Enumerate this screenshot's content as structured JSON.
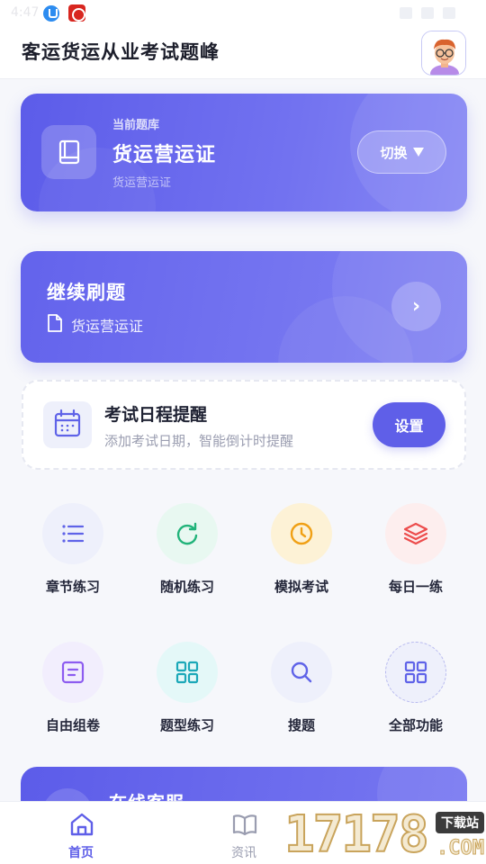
{
  "status_bar": {
    "time": "4:47"
  },
  "header": {
    "title": "客运货运从业考试题峰"
  },
  "current_bank": {
    "label": "当前题库",
    "name": "货运营运证",
    "sub": "货运营运证",
    "switch_label": "切换"
  },
  "continue_card": {
    "title": "继续刷题",
    "sub": "货运营运证",
    "arrow": "›"
  },
  "reminder": {
    "title": "考试日程提醒",
    "sub": "添加考试日期，智能倒计时提醒",
    "button": "设置"
  },
  "features": [
    {
      "label": "章节练习",
      "icon": "list-icon",
      "color": "#5f63e8",
      "bg": "#eef0fb"
    },
    {
      "label": "随机练习",
      "icon": "refresh-icon",
      "color": "#21b37a",
      "bg": "#e8f8f1"
    },
    {
      "label": "模拟考试",
      "icon": "clock-icon",
      "color": "#f0a015",
      "bg": "#fdf2d6"
    },
    {
      "label": "每日一练",
      "icon": "layers-icon",
      "color": "#ec4c4c",
      "bg": "#fdeeee"
    },
    {
      "label": "自由组卷",
      "icon": "document-icon",
      "color": "#8d5cf0",
      "bg": "#f2eefd"
    },
    {
      "label": "题型练习",
      "icon": "grid-icon",
      "color": "#1ba8b8",
      "bg": "#e4f8f8"
    },
    {
      "label": "搜题",
      "icon": "search-icon",
      "color": "#5f63e8",
      "bg": "#eef0fb"
    },
    {
      "label": "全部功能",
      "icon": "grid-icon",
      "color": "#5f63e8",
      "bg": "#eef0fb"
    }
  ],
  "service_card": {
    "title": "在线客服"
  },
  "bottom_nav": [
    {
      "label": "首页",
      "icon": "home-icon",
      "active": true
    },
    {
      "label": "资讯",
      "icon": "book-icon",
      "active": false
    }
  ],
  "watermark": {
    "number": "17178",
    "tag": "下载站",
    "com": ".COM"
  },
  "colors": {
    "accent": "#5f5fe8",
    "accent_light": "#7878f1",
    "background": "#f6f7fb"
  }
}
